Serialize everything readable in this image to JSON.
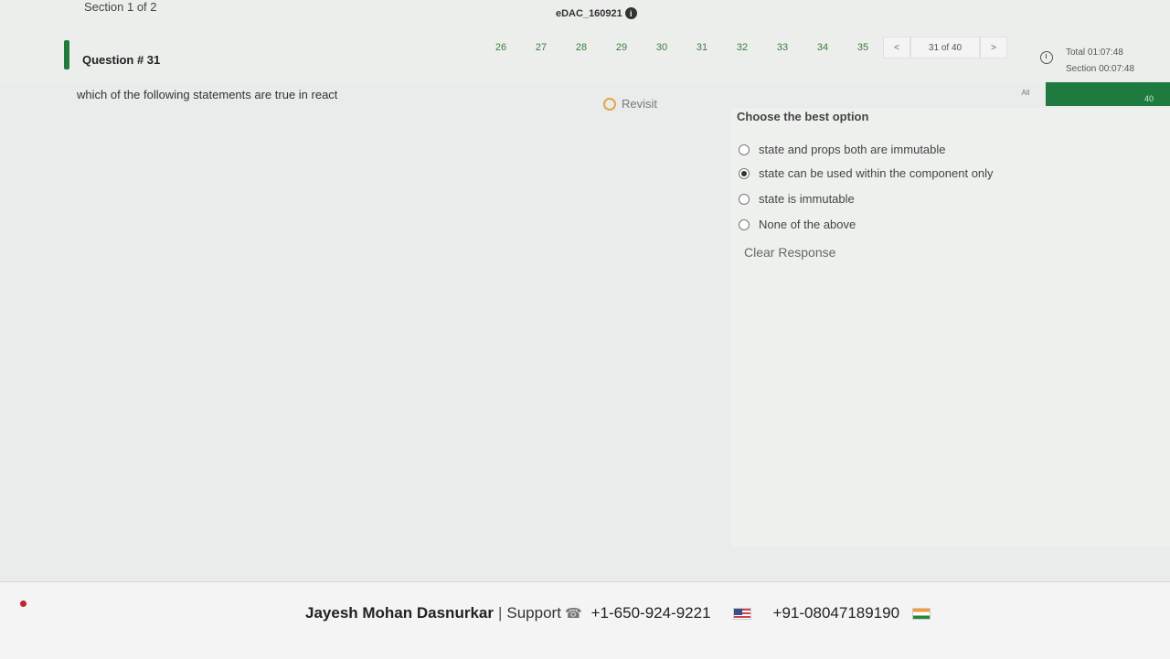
{
  "header": {
    "section": "Section 1 of 2",
    "exam_id": "eDAC_160921",
    "info_icon": "info-icon"
  },
  "question_nav": {
    "numbers": [
      "26",
      "27",
      "28",
      "29",
      "30",
      "31",
      "32",
      "33",
      "34",
      "35"
    ],
    "prev": "<",
    "counter": "31 of 40",
    "next": ">"
  },
  "timer": {
    "total": "Total 01:07:48",
    "section": "Section 00:07:48",
    "icon": "clock-icon"
  },
  "filter": {
    "all_label": "All",
    "count": "40"
  },
  "question": {
    "title": "Question # 31",
    "text": "which of the following statements are true in react",
    "revisit_label": "Revisit"
  },
  "options": {
    "header": "Choose the best option",
    "items": [
      {
        "label": "state and props both are immutable",
        "selected": false
      },
      {
        "label": "state can be used within the component only",
        "selected": true
      },
      {
        "label": "state is immutable",
        "selected": false
      },
      {
        "label": "None of the above",
        "selected": false
      }
    ],
    "clear_label": "Clear Response"
  },
  "footer": {
    "candidate": "Jayesh Mohan Dasnurkar",
    "separator": "|",
    "support_label": "Support",
    "phone_us": "+1-650-924-9221",
    "phone_in": "+91-08047189190"
  },
  "colors": {
    "accent_green": "#1f7a3c",
    "revisit_orange": "#e7a34a",
    "record_red": "#c0262d"
  }
}
